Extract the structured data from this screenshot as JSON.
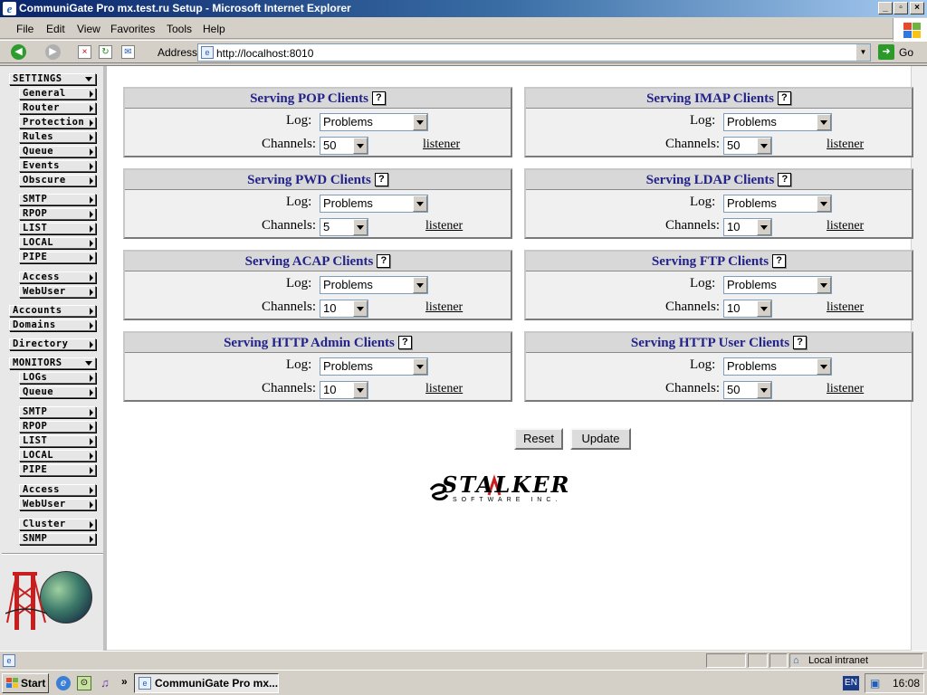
{
  "window": {
    "title": "CommuniGate Pro mx.test.ru Setup - Microsoft Internet Explorer"
  },
  "menubar": {
    "items": [
      "File",
      "Edit",
      "View",
      "Favorites",
      "Tools",
      "Help"
    ]
  },
  "addressbar": {
    "label": "Address",
    "url": "http://localhost:8010",
    "go_label": "Go"
  },
  "sidebar": {
    "settings_header": "SETTINGS",
    "settings_items": [
      "General",
      "Router",
      "Protection",
      "Rules",
      "Queue",
      "Events",
      "Obscure"
    ],
    "protocol_items": [
      "SMTP",
      "RPOP",
      "LIST",
      "LOCAL",
      "PIPE"
    ],
    "access_items": [
      "Access",
      "WebUser"
    ],
    "accounts": "Accounts",
    "domains": "Domains",
    "directory": "Directory",
    "monitors_header": "MONITORS",
    "monitor_items": [
      "LOGs",
      "Queue"
    ],
    "monitor_protocol_items": [
      "SMTP",
      "RPOP",
      "LIST",
      "LOCAL",
      "PIPE"
    ],
    "monitor_access_items": [
      "Access",
      "WebUser"
    ],
    "cluster_items": [
      "Cluster",
      "SNMP"
    ]
  },
  "help_glyph": "?",
  "panels": [
    {
      "title": "Serving POP Clients",
      "log_label": "Log:",
      "log_value": "Problems",
      "channels_label": "Channels:",
      "channels_value": "50",
      "link": "listener"
    },
    {
      "title": "Serving IMAP Clients",
      "log_label": "Log:",
      "log_value": "Problems",
      "channels_label": "Channels:",
      "channels_value": "50",
      "link": "listener"
    },
    {
      "title": "Serving PWD Clients",
      "log_label": "Log:",
      "log_value": "Problems",
      "channels_label": "Channels:",
      "channels_value": "5",
      "link": "listener"
    },
    {
      "title": "Serving LDAP Clients",
      "log_label": "Log:",
      "log_value": "Problems",
      "channels_label": "Channels:",
      "channels_value": "10",
      "link": "listener"
    },
    {
      "title": "Serving ACAP Clients",
      "log_label": "Log:",
      "log_value": "Problems",
      "channels_label": "Channels:",
      "channels_value": "10",
      "link": "listener"
    },
    {
      "title": "Serving FTP Clients",
      "log_label": "Log:",
      "log_value": "Problems",
      "channels_label": "Channels:",
      "channels_value": "10",
      "link": "listener"
    },
    {
      "title": "Serving HTTP Admin Clients",
      "log_label": "Log:",
      "log_value": "Problems",
      "channels_label": "Channels:",
      "channels_value": "10",
      "link": "listener"
    },
    {
      "title": "Serving HTTP User Clients",
      "log_label": "Log:",
      "log_value": "Problems",
      "channels_label": "Channels:",
      "channels_value": "50",
      "link": "listener"
    }
  ],
  "buttons": {
    "reset": "Reset",
    "update": "Update"
  },
  "brand": {
    "name": "STALKER",
    "tagline": "SOFTWARE INC."
  },
  "statusbar": {
    "zone": "Local intranet"
  },
  "taskbar": {
    "start": "Start",
    "task": "CommuniGate Pro mx...",
    "lang": "EN",
    "clock": "16:08"
  }
}
